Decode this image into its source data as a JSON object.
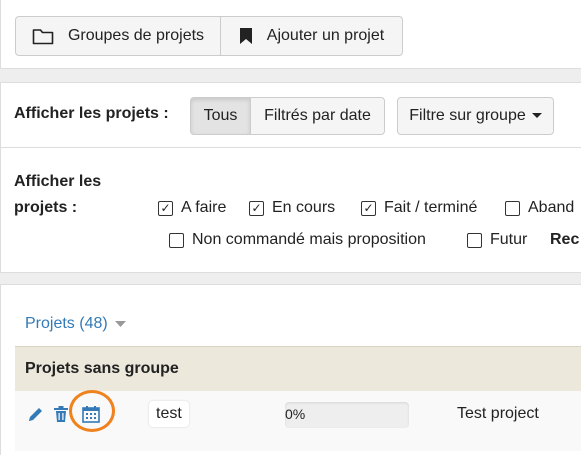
{
  "toolbar": {
    "groups_label": "Groupes de projets",
    "add_label": "Ajouter un projet"
  },
  "filter_date": {
    "label": "Afficher les projets :",
    "all_label": "Tous",
    "by_date_label": "Filtrés par date",
    "group_filter_label": "Filtre sur groupe"
  },
  "filter_status": {
    "label_line1": "Afficher les",
    "label_line2": "projets :",
    "options": [
      {
        "label": "A faire",
        "checked": true
      },
      {
        "label": "En cours",
        "checked": true
      },
      {
        "label": "Fait / terminé",
        "checked": true
      },
      {
        "label": "Aband",
        "checked": false
      },
      {
        "label": "Non commandé mais proposition",
        "checked": false
      },
      {
        "label": "Futur",
        "checked": false
      }
    ],
    "trailing_text": "Rec"
  },
  "projects": {
    "heading": "Projets (48)",
    "group_title": "Projets sans groupe",
    "rows": [
      {
        "name": "test",
        "progress_text": "0%",
        "progress": 0,
        "title": "Test project"
      }
    ]
  },
  "colors": {
    "link": "#337ab7",
    "group_header_bg": "#ece9dc",
    "highlight_ring": "#f0821e"
  }
}
